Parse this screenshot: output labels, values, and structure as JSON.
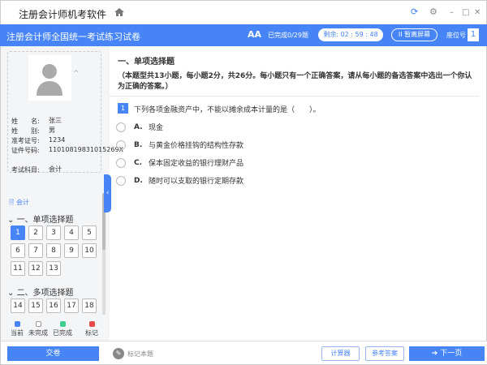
{
  "app": {
    "title": "注册会计师机考软件"
  },
  "header": {
    "exam_title": "注册会计师全国统一考试练习试卷",
    "font_icon": "AA",
    "progress": "已完成0/29题",
    "timer": "剩余: 02 : 59 : 48",
    "pause": "II 暂离屏幕",
    "seat_label": "座位号",
    "seat_no": "1"
  },
  "candidate": {
    "fields": [
      {
        "k": "姓　　名:",
        "v": "张三"
      },
      {
        "k": "姓　　别:",
        "v": "男"
      },
      {
        "k": "准考证号:",
        "v": "1234"
      },
      {
        "k": "证件号码:",
        "v": "11010819831015269X"
      },
      {
        "k": "考试科目:",
        "v": "会计"
      }
    ]
  },
  "nav": {
    "subject": "会计",
    "sections": [
      {
        "title": "一、单项选择题",
        "questions": [
          "1",
          "2",
          "3",
          "4",
          "5",
          "6",
          "7",
          "8",
          "9",
          "10",
          "11",
          "12",
          "13"
        ]
      },
      {
        "title": "二、多项选择题",
        "questions": [
          "14",
          "15",
          "16",
          "17",
          "18"
        ]
      }
    ],
    "legend": [
      {
        "label": "当前",
        "color": "#4784f5"
      },
      {
        "label": "未完成",
        "color": "#ffffff"
      },
      {
        "label": "已完成",
        "color": "#3ecf8e"
      },
      {
        "label": "标记",
        "color": "#e84a4a"
      }
    ]
  },
  "main": {
    "section_title": "一、单项选择题",
    "section_desc": "（本题型共13小题，每小题2分，共26分。每小题只有一个正确答案，请从每小题的备选答案中选出一个你认为正确的答案。）",
    "question": {
      "number": "1",
      "text": "下列各项金融资产中，不能以摊余成本计量的是（　　）。",
      "options": [
        {
          "letter": "A.",
          "text": "现金"
        },
        {
          "letter": "B.",
          "text": "与黄金价格挂钩的结构性存款"
        },
        {
          "letter": "C.",
          "text": "保本固定收益的银行理财产品"
        },
        {
          "letter": "D.",
          "text": "随时可以支取的银行定期存款"
        }
      ]
    }
  },
  "footer": {
    "submit": "交卷",
    "mark": "标记本题",
    "calculator": "计算器",
    "answer": "参考答案",
    "next": "下一页"
  }
}
